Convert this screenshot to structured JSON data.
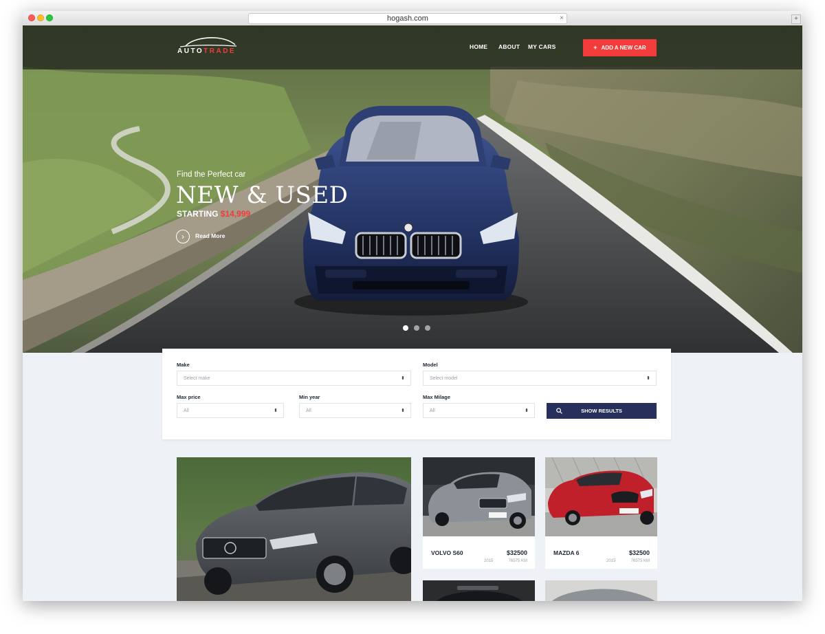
{
  "browser": {
    "url": "hogash.com",
    "close_glyph": "×",
    "newtab_glyph": "+"
  },
  "brand": {
    "name_part1": "AUTO",
    "name_part2": "TRADE",
    "accent_color": "#f23b3b",
    "navy_color": "#27305b"
  },
  "nav": {
    "items": [
      {
        "label": "HOME"
      },
      {
        "label": "ABOUT"
      },
      {
        "label": "MY CARS"
      }
    ],
    "cta_label": "ADD A NEW CAR",
    "cta_icon": "plus-icon"
  },
  "hero": {
    "subtitle": "Find the Perfect car",
    "title": "NEW & USED",
    "price_prefix": "STARTING",
    "price_value": "$14,999",
    "read_more_label": "Read More",
    "read_more_icon": "chevron-right-icon",
    "slides_total": 3,
    "active_slide": 1
  },
  "search": {
    "make": {
      "label": "Make",
      "placeholder": "Select make"
    },
    "model": {
      "label": "Model",
      "placeholder": "Select model"
    },
    "max_price": {
      "label": "Max price",
      "value": "All"
    },
    "min_year": {
      "label": "Min year",
      "value": "All"
    },
    "max_mileage": {
      "label": "Max Milage",
      "value": "All"
    },
    "submit_label": "SHOW RESULTS",
    "submit_icon": "search-icon",
    "select_arrows": "⬍"
  },
  "listings": [
    {
      "name": "VOLVO S60",
      "price": "$32500",
      "year": "2015",
      "mileage": "76575 KM",
      "color": "#8b9196"
    },
    {
      "name": "MAZDA 6",
      "price": "$32500",
      "year": "2015",
      "mileage": "76575 KM",
      "color": "#c0202a"
    }
  ]
}
